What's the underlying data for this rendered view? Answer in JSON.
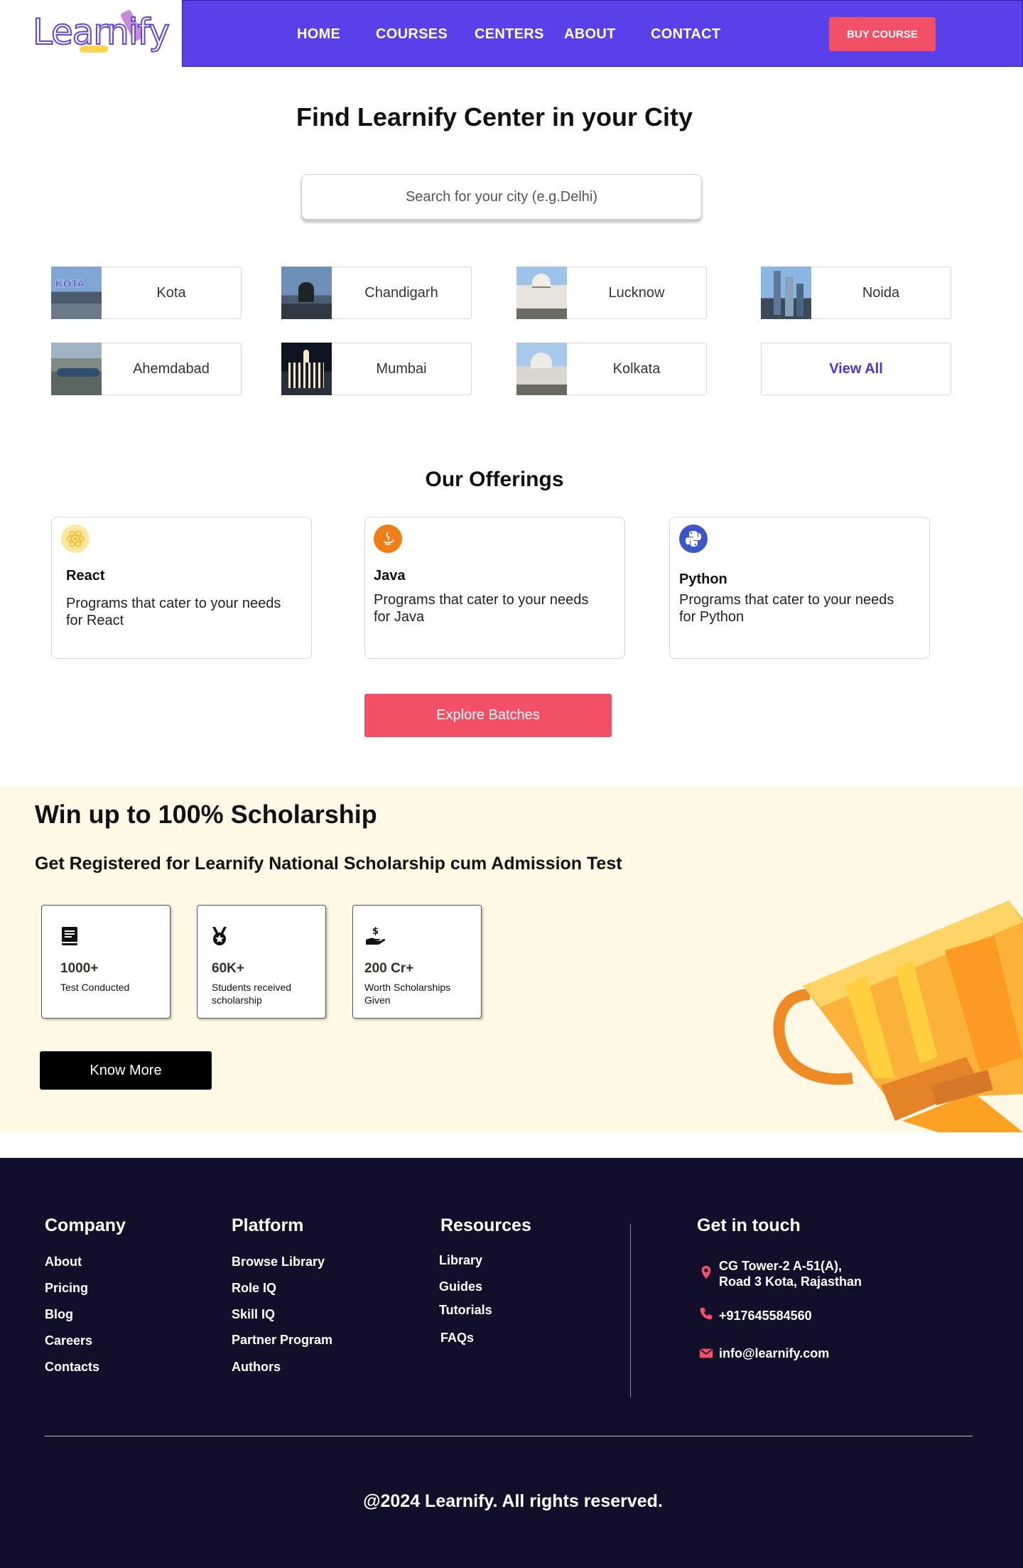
{
  "brand": {
    "logo_text": "Learnify"
  },
  "nav": {
    "items": [
      {
        "label": "HOME"
      },
      {
        "label": "COURSES"
      },
      {
        "label": "CENTERS"
      },
      {
        "label": "ABOUT"
      },
      {
        "label": "CONTACT"
      }
    ],
    "buy_label": "BUY COURSE"
  },
  "centers": {
    "title": "Find Learnify Center in your City",
    "search_placeholder": "Search for your city (e.g.Delhi)",
    "thumb_kota_text": "KOTA",
    "cities": [
      {
        "name": "Kota"
      },
      {
        "name": "Chandigarh"
      },
      {
        "name": "Lucknow"
      },
      {
        "name": "Noida"
      },
      {
        "name": "Ahemdabad"
      },
      {
        "name": "Mumbai"
      },
      {
        "name": "Kolkata"
      }
    ],
    "view_all_label": "View All"
  },
  "offerings": {
    "title": "Our Offerings",
    "cards": [
      {
        "title": "React",
        "description": "Programs that cater to your needs for React",
        "icon": "react-icon"
      },
      {
        "title": "Java",
        "description": "Programs that cater to your needs for Java",
        "icon": "java-icon"
      },
      {
        "title": "Python",
        "description": "Programs that cater to your needs for Python",
        "icon": "python-icon"
      }
    ],
    "explore_label": "Explore Batches"
  },
  "scholarship": {
    "title": "Win up to 100% Scholarship",
    "subtitle": "Get Registered for Learnify National Scholarship cum Admission Test",
    "stats": [
      {
        "value": "1000+",
        "label": "Test Conducted",
        "icon": "book-icon"
      },
      {
        "value": "60K+",
        "label": "Students received scholarship",
        "icon": "medal-icon"
      },
      {
        "value": "200 Cr+",
        "label": "Worth Scholarships Given",
        "icon": "hand-money-icon"
      }
    ],
    "know_more_label": "Know More"
  },
  "footer": {
    "company": {
      "heading": "Company",
      "links": [
        "About",
        "Pricing",
        "Blog",
        "Careers",
        "Contacts"
      ]
    },
    "platform": {
      "heading": "Platform",
      "links": [
        "Browse Library",
        "Role IQ",
        "Skill IQ",
        "Partner Program",
        "Authors"
      ]
    },
    "resources": {
      "heading": "Resources",
      "links": [
        "Library",
        "Guides",
        "Tutorials",
        "FAQs"
      ]
    },
    "contact": {
      "heading": "Get in touch",
      "address_line1": "CG Tower-2 A-51(A),",
      "address_line2": "Road 3 Kota, Rajasthan",
      "phone": "+917645584560",
      "email": "info@learnify.com"
    },
    "copyright": "@2024 Learnify. All rights reserved."
  },
  "colors": {
    "nav_bg": "#5a40e8",
    "accent_red": "#f15066",
    "scholarship_bg": "#fff8e5",
    "footer_bg": "#120f2b",
    "view_all": "#4a34d6"
  }
}
